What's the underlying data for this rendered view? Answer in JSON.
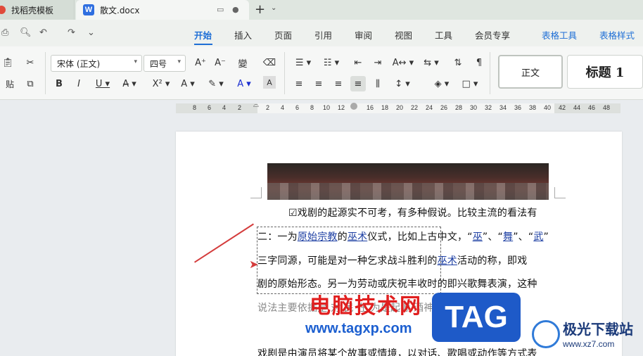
{
  "tabs": [
    {
      "label": "找稻壳模板"
    },
    {
      "label": "散文.docx"
    }
  ],
  "menu": {
    "items": [
      "开始",
      "插入",
      "页面",
      "引用",
      "审阅",
      "视图",
      "工具",
      "会员专享"
    ],
    "contextual": [
      "表格工具",
      "表格样式"
    ]
  },
  "ribbon": {
    "font_name": "宋体 (正文)",
    "font_size": "四号",
    "paste_label": "贴",
    "styles": {
      "normal": "正文",
      "heading1": "标题 1"
    }
  },
  "ruler": {
    "ticks": [
      "8",
      "6",
      "4",
      "2",
      "2",
      "4",
      "6",
      "8",
      "10",
      "12",
      "16",
      "18",
      "20",
      "22",
      "24",
      "26",
      "28",
      "30",
      "32",
      "34",
      "36",
      "38",
      "40",
      "42",
      "44",
      "46",
      "48"
    ]
  },
  "document": {
    "line1": "☑戏剧的起源实不可考，有多种假说。比较主流的看法有",
    "line2_pre": "二：一为",
    "line2_link1": "原始宗教",
    "line2_mid1": "的",
    "line2_link2": "巫术",
    "line2_mid2": "仪式，比如上古中文，“",
    "line2_link3": "巫",
    "line2_mid3": "”、“",
    "line2_link4": "舞",
    "line2_mid4": "”、“",
    "line2_link5": "武",
    "line2_end": "”",
    "line3_pre": "三字同源，可能是对一种乞求战斗胜利的",
    "line3_link": "巫术",
    "line3_end": "活动的称，即戏",
    "line4": "剧的原始形态。另一为劳动或庆祝丰收时的即兴歌舞表演，这种",
    "line5": "说法主要依据是  对   民   在   为是起源   酒神祭祀",
    "line6": "戏剧是由演员将某个故事或情境，以对话、歌唱或动作等方式表"
  },
  "watermarks": {
    "red_text": "电脑技术网",
    "url": "www.tagxp.com",
    "tag": "TAG",
    "site_name": "极光下载站",
    "site_url": "www.xz7.com"
  },
  "colors": {
    "accent": "#1f6fd6",
    "arrow": "#d43c3c"
  }
}
